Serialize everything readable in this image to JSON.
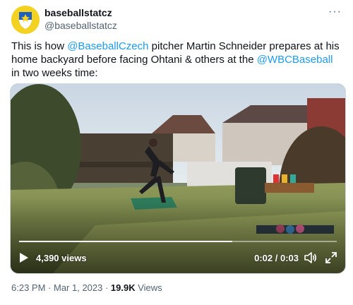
{
  "account": {
    "display_name": "baseballstatcz",
    "handle": "@baseballstatcz",
    "avatar_icon": "shield-logo-icon",
    "avatar_colors": [
      "#f4d222",
      "#1f5fbf"
    ]
  },
  "menu": {
    "more_label": "···"
  },
  "tweet": {
    "text_1": "This is how ",
    "mention_1": "@BaseballCzech",
    "text_2": " pitcher Martin Schneider prepares at his home backyard before facing Ohtani & others at the ",
    "mention_2": "@WBCBaseball",
    "text_3": " in two weeks time:",
    "link_color": "#1d9bf0"
  },
  "video": {
    "views": "4,390 views",
    "current_time": "0:02",
    "time_separator": " / ",
    "duration": "0:03",
    "progress": 0.67,
    "icons": [
      "play-icon",
      "volume-icon",
      "fullscreen-icon"
    ]
  },
  "meta": {
    "time": "6:23 PM",
    "separator_1": " · ",
    "date": "Mar 1, 2023",
    "separator_2": " · ",
    "views_count": "19.9K",
    "views_label": " Views"
  }
}
